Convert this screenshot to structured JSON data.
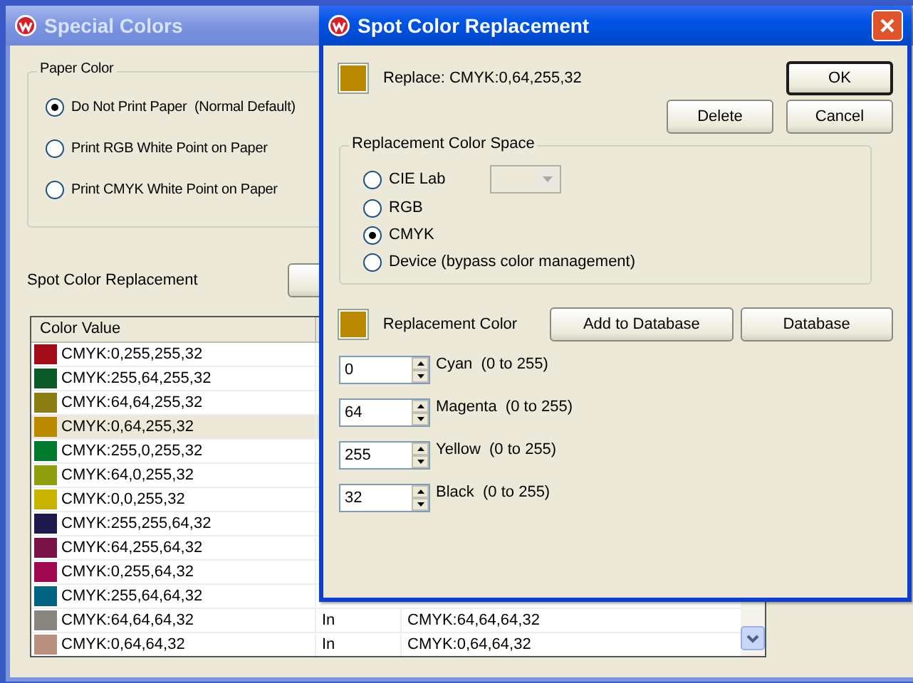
{
  "main_window": {
    "title": "Special Colors",
    "active": false,
    "paper_color": {
      "title": "Paper Color",
      "options": [
        {
          "label": "Do Not Print Paper  (Normal Default)",
          "selected": true
        },
        {
          "label": "Print RGB White Point on Paper",
          "selected": false
        },
        {
          "label": "Print CMYK White Point on Paper",
          "selected": false
        }
      ]
    },
    "spot_label": "Spot Color Replacement",
    "table": {
      "columns": [
        "Color Value"
      ],
      "rows": [
        {
          "color": "#a00c18",
          "color_value": "CMYK:0,255,255,32",
          "selected": false
        },
        {
          "color": "#0a5a28",
          "color_value": "CMYK:255,64,255,32",
          "selected": false
        },
        {
          "color": "#8c7c14",
          "color_value": "CMYK:64,64,255,32",
          "selected": false
        },
        {
          "color": "#b98a00",
          "color_value": "CMYK:0,64,255,32",
          "selected": true
        },
        {
          "color": "#007a2c",
          "color_value": "CMYK:255,0,255,32",
          "selected": false
        },
        {
          "color": "#8ea010",
          "color_value": "CMYK:64,0,255,32",
          "selected": false
        },
        {
          "color": "#c8b400",
          "color_value": "CMYK:0,0,255,32",
          "selected": false
        },
        {
          "color": "#1e1a50",
          "color_value": "CMYK:255,255,64,32",
          "selected": false
        },
        {
          "color": "#7a1248",
          "color_value": "CMYK:64,255,64,32",
          "selected": false
        },
        {
          "color": "#a00850",
          "color_value": "CMYK:0,255,64,32",
          "selected": false
        },
        {
          "color": "#006480",
          "color_value": "CMYK:255,64,64,32",
          "selected": false
        },
        {
          "color": "#888480",
          "color_value": "CMYK:64,64,64,32",
          "column_2": "In",
          "column_3": "CMYK:64,64,64,32",
          "selected": false
        },
        {
          "color": "#b89080",
          "color_value": "CMYK:0,64,64,32",
          "column_2": "In",
          "column_3": "CMYK:0,64,64,32",
          "selected": false
        }
      ]
    }
  },
  "dialog": {
    "title": "Spot Color Replacement",
    "active": true,
    "replace_swatch": {
      "color": "#b98800"
    },
    "replace_text": "Replace: CMYK:0,64,255,32",
    "buttons": [
      {
        "label": "OK",
        "default": true
      },
      {
        "label": "Delete",
        "default": false
      },
      {
        "label": "Cancel",
        "default": false
      }
    ],
    "color_space": {
      "title": "Replacement Color Space",
      "options": [
        {
          "label": "CIE Lab",
          "selected": false,
          "kind": "combo"
        },
        {
          "label": "RGB",
          "selected": false,
          "kind": "plain"
        },
        {
          "label": "CMYK",
          "selected": true,
          "kind": "plain"
        },
        {
          "label": "Device (bypass color management)",
          "selected": false,
          "kind": "plain"
        }
      ],
      "combo_disabled": true
    },
    "replacement": {
      "color": "#b98800",
      "label": "Replacement Color",
      "buttons": [
        "Add to Database",
        "Database"
      ]
    },
    "channels": [
      {
        "value": "0",
        "label": "Cyan  (0 to 255)"
      },
      {
        "value": "64",
        "label": "Magenta  (0 to 255)"
      },
      {
        "value": "255",
        "label": "Yellow  (0 to 255)"
      },
      {
        "value": "32",
        "label": "Black  (0 to 255)"
      }
    ]
  }
}
